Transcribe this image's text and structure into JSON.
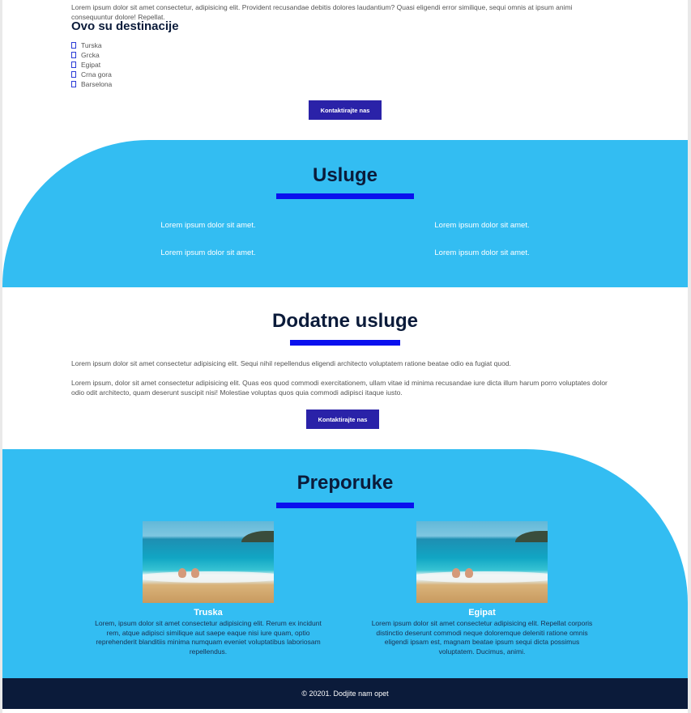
{
  "top": {
    "intro": "Lorem ipsum dolor sit amet consectetur, adipisicing elit. Provident recusandae debitis dolores laudantium? Quasi eligendi error similique, sequi omnis at ipsum animi consequuntur dolore! Repellat.",
    "destinations_title": "Ovo su destinacije",
    "destinations": [
      "Turska",
      "Grcka",
      "Egipat",
      "Crna gora",
      "Barselona"
    ],
    "button_label": "Kontaktirajte nas"
  },
  "services": {
    "title": "Usluge",
    "items": [
      "Lorem ipsum dolor sit amet.",
      "Lorem ipsum dolor sit amet.",
      "Lorem ipsum dolor sit amet.",
      "Lorem ipsum dolor sit amet."
    ]
  },
  "extra": {
    "title": "Dodatne usluge",
    "paragraphs": [
      "Lorem ipsum dolor sit amet consectetur adipisicing elit. Sequi nihil repellendus eligendi architecto voluptatem ratione beatae odio ea fugiat quod.",
      "Lorem ipsum, dolor sit amet consectetur adipisicing elit. Quas eos quod commodi exercitationem, ullam vitae id minima recusandae iure dicta illum harum porro voluptates dolor odio odit architecto, quam deserunt suscipit nisi! Molestiae voluptas quos quia commodi adipisci itaque iusto."
    ],
    "button_label": "Kontaktirajte nas"
  },
  "recommendations": {
    "title": "Preporuke",
    "cards": [
      {
        "name": "Truska",
        "description": "Lorem, ipsum dolor sit amet consectetur adipisicing elit. Rerum ex incidunt rem, atque adipisci similique aut saepe eaque nisi iure quam, optio reprehenderit blanditiis minima numquam eveniet voluptatibus laboriosam repellendus."
      },
      {
        "name": "Egipat",
        "description": "Lorem ipsum dolor sit amet consectetur adipisicing elit. Repellat corporis distinctio deserunt commodi neque doloremque deleniti ratione omnis eligendi ipsam est, magnam beatae ipsum sequi dicta possimus voluptatem. Ducimus, animi."
      }
    ]
  },
  "footer": {
    "text": "© 20201. Dodjite nam opet"
  },
  "colors": {
    "accent_blue": "#33bdf2",
    "underline_blue": "#0a10ee",
    "button_bg": "#2a22a8",
    "dark_navy": "#0b1b3a"
  }
}
